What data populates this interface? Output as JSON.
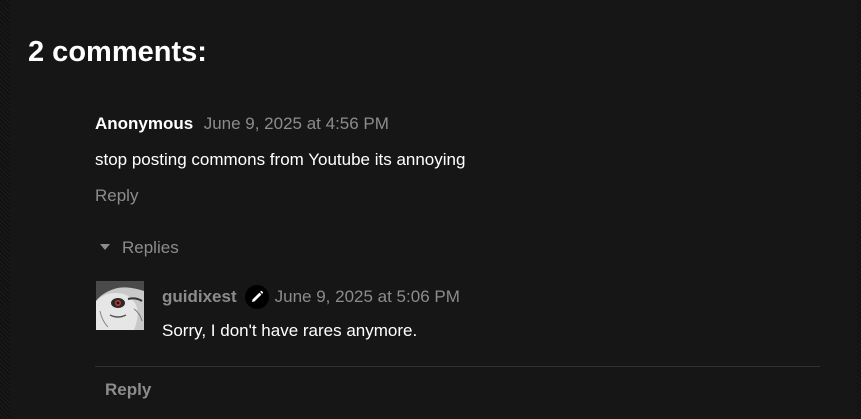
{
  "comments_section": {
    "title": "2 comments:",
    "comment": {
      "author": "Anonymous",
      "timestamp": "June 9, 2025 at 4:56 PM",
      "text": "stop posting commons from Youtube its annoying",
      "reply_label": "Reply"
    },
    "replies_toggle_label": "Replies",
    "reply": {
      "author": "guidixest",
      "author_badge_icon": "pencil-icon",
      "timestamp": "June 9, 2025 at 5:06 PM",
      "text": "Sorry, I don't have rares anymore."
    },
    "bottom_reply_label": "Reply"
  },
  "colors": {
    "background": "#141414",
    "primary_text": "#ffffff",
    "secondary_text": "#8c8c8c"
  }
}
